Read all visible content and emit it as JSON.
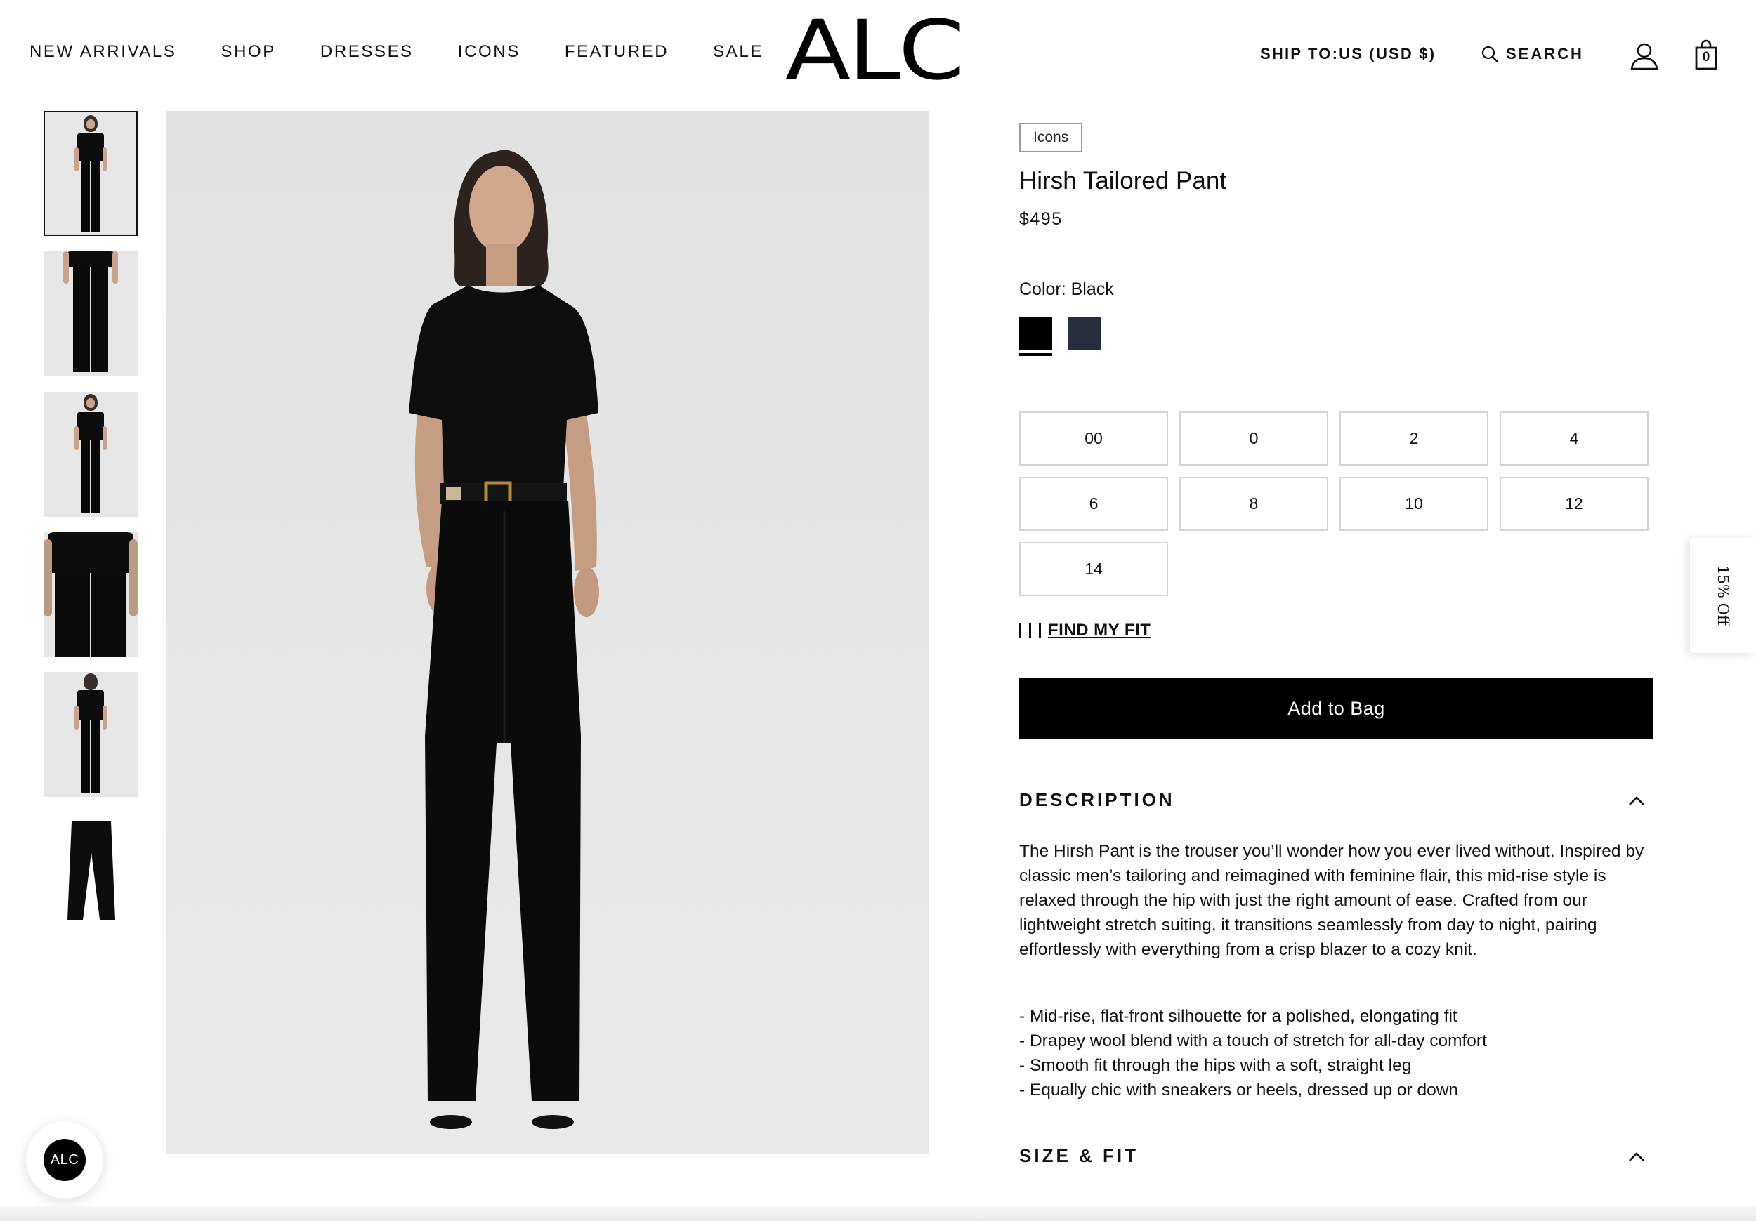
{
  "header": {
    "nav": [
      "NEW ARRIVALS",
      "SHOP",
      "DRESSES",
      "ICONS",
      "FEATURED",
      "SALE"
    ],
    "logo": "ALC",
    "ship_to": "SHIP TO:US (USD $)",
    "search_label": "SEARCH",
    "bag_count": "0"
  },
  "gallery": {
    "thumbnails": [
      "front-full",
      "legs-front",
      "front-full-2",
      "back-detail",
      "back-full",
      "flat-lay"
    ],
    "selected_index": 0
  },
  "product": {
    "badge": "Icons",
    "title": "Hirsh Tailored Pant",
    "price": "$495",
    "color_label": "Color: Black",
    "swatches": [
      {
        "name": "Black",
        "hex": "#000000",
        "selected": true
      },
      {
        "name": "Navy",
        "hex": "#2a2d40",
        "selected": false
      }
    ],
    "sizes": [
      "00",
      "0",
      "2",
      "4",
      "6",
      "8",
      "10",
      "12",
      "14"
    ],
    "find_fit": "FIND MY FIT",
    "add_to_bag": "Add to Bag"
  },
  "description": {
    "heading": "DESCRIPTION",
    "text": "The Hirsh Pant is the trouser you’ll wonder how you ever lived without. Inspired by classic men’s tailoring and reimagined with feminine flair, this mid-rise style is relaxed through the hip with just the right amount of ease. Crafted from our lightweight stretch suiting, it transitions seamlessly from day to night, pairing effortlessly with everything from a crisp blazer to a cozy knit.",
    "bullets": [
      "- Mid-rise, flat-front silhouette for a polished, elongating fit",
      "- Drapey wool blend with a touch of stretch for all-day comfort",
      "- Smooth fit through the hips with a soft, straight leg",
      "- Equally chic with sneakers or heels, dressed up or down"
    ]
  },
  "size_fit": {
    "heading": "SIZE & FIT"
  },
  "promo": {
    "label": "15% Off"
  },
  "chat": {
    "label": "ALC"
  }
}
